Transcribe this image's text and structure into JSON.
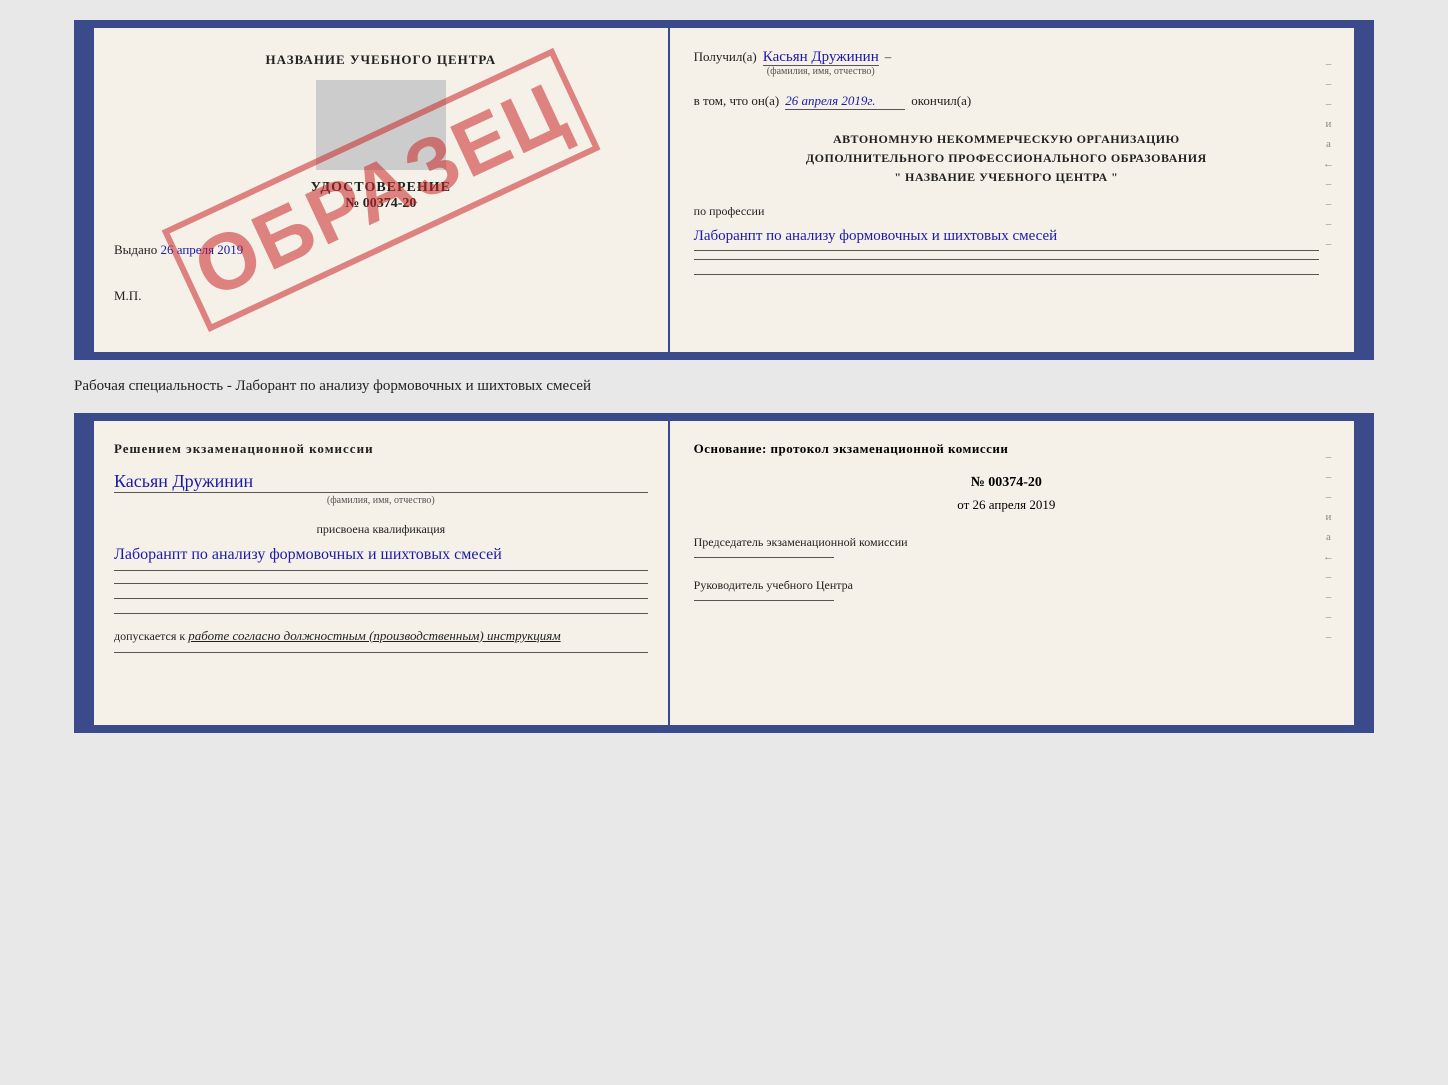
{
  "top_certificate": {
    "left": {
      "title": "НАЗВАНИЕ УЧЕБНОГО ЦЕНТРА",
      "document_type": "УДОСТОВЕРЕНИЕ",
      "document_number": "№ 00374-20",
      "vydano_label": "Выдано",
      "vydano_date": "26 апреля 2019",
      "mp_label": "М.П.",
      "obrazets": "ОБРАЗЕЦ"
    },
    "right": {
      "poluchil_label": "Получил(а)",
      "poluchil_value": "Касьян Дружинин",
      "fio_sublabel": "(фамилия, имя, отчество)",
      "vtom_label": "в том, что он(а)",
      "vtom_date": "26 апреля 2019г.",
      "okonchil_label": "окончил(а)",
      "org_line1": "АВТОНОМНУЮ НЕКОММЕРЧЕСКУЮ ОРГАНИЗАЦИЮ",
      "org_line2": "ДОПОЛНИТЕЛЬНОГО ПРОФЕССИОНАЛЬНОГО ОБРАЗОВАНИЯ",
      "org_line3": "\"   НАЗВАНИЕ УЧЕБНОГО ЦЕНТРА   \"",
      "profession_label": "по профессии",
      "profession_value": "Лаборанпт по анализу формовочных и шихтовых смесей",
      "dash1": "–",
      "dash2": "–",
      "dash3": "–",
      "letter_i": "и",
      "letter_a": "а",
      "left_arrow": "←"
    }
  },
  "specialty_line": "Рабочая специальность - Лаборант по анализу формовочных и шихтовых смесей",
  "bottom_certificate": {
    "left": {
      "section_title": "Решением экзаменационной комиссии",
      "name_value": "Касьян Дружинин",
      "name_sublabel": "(фамилия, имя, отчество)",
      "qualification_label": "присвоена квалификация",
      "qualification_value": "Лаборанпт по анализу формовочных и шихтовых смесей",
      "dopuskaetsya_label": "допускается к",
      "dopuskaetsya_value": "работе согласно должностным (производственным) инструкциям"
    },
    "right": {
      "title": "Основание: протокол экзаменационной комиссии",
      "protocol_number": "№ 00374-20",
      "protocol_date_prefix": "от",
      "protocol_date": "26 апреля 2019",
      "chairman_label": "Председатель экзаменационной комиссии",
      "rukovoditel_label": "Руководитель учебного Центра",
      "dash1": "–",
      "dash2": "–",
      "dash3": "–",
      "letter_i": "и",
      "letter_a": "а",
      "left_arrow": "←"
    }
  }
}
